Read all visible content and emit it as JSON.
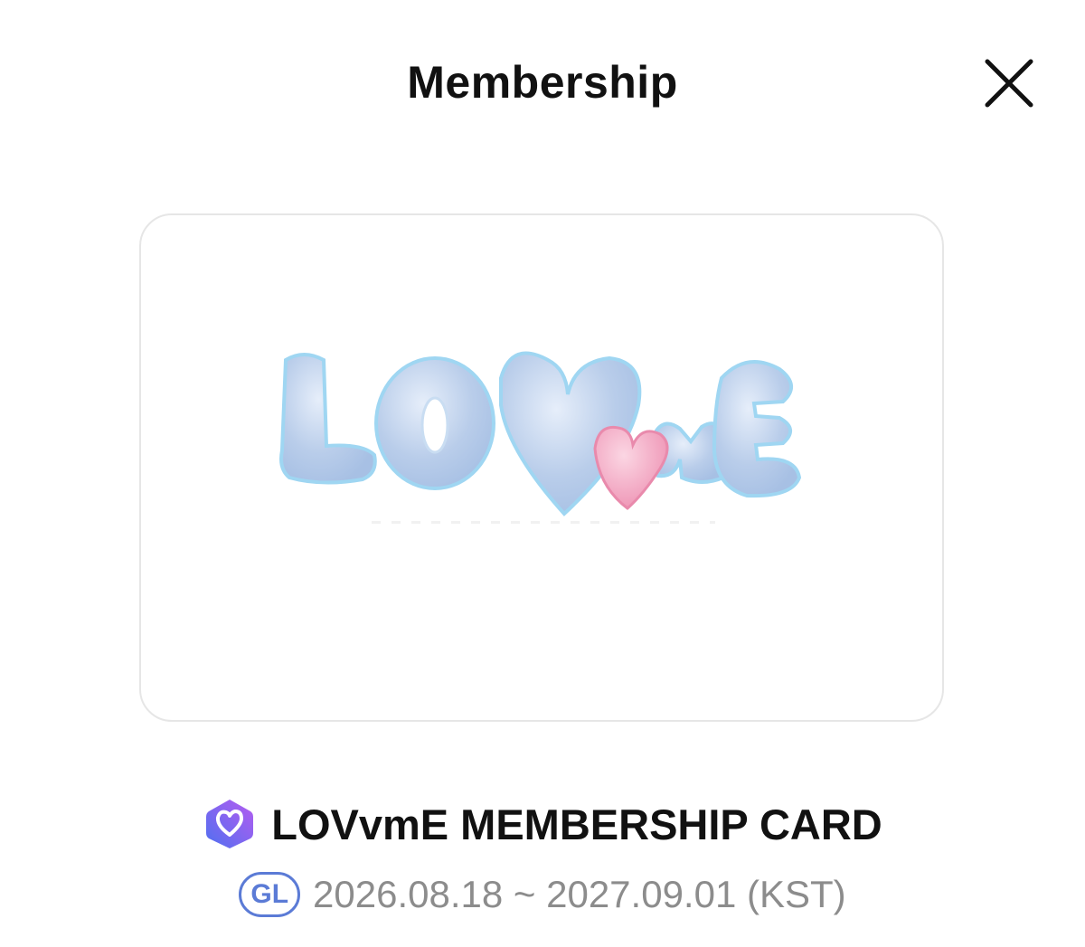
{
  "header": {
    "title": "Membership",
    "close_icon": "close-icon"
  },
  "card": {
    "logo_text": "LOVvmE",
    "colors": {
      "bubble_blue": "#b8cdea",
      "bubble_outline": "#9fd3f0",
      "heart_pink": "#f2a3c0"
    }
  },
  "membership": {
    "badge_icon": "heart-shield-icon",
    "name": "LOVvmE MEMBERSHIP CARD",
    "level": "GL",
    "period": "2026.08.18 ~ 2027.09.01 (KST)",
    "colors": {
      "badge_gradient_start": "#5a6ff0",
      "badge_gradient_end": "#b45cf0",
      "level_color": "#5b7bd6"
    }
  }
}
